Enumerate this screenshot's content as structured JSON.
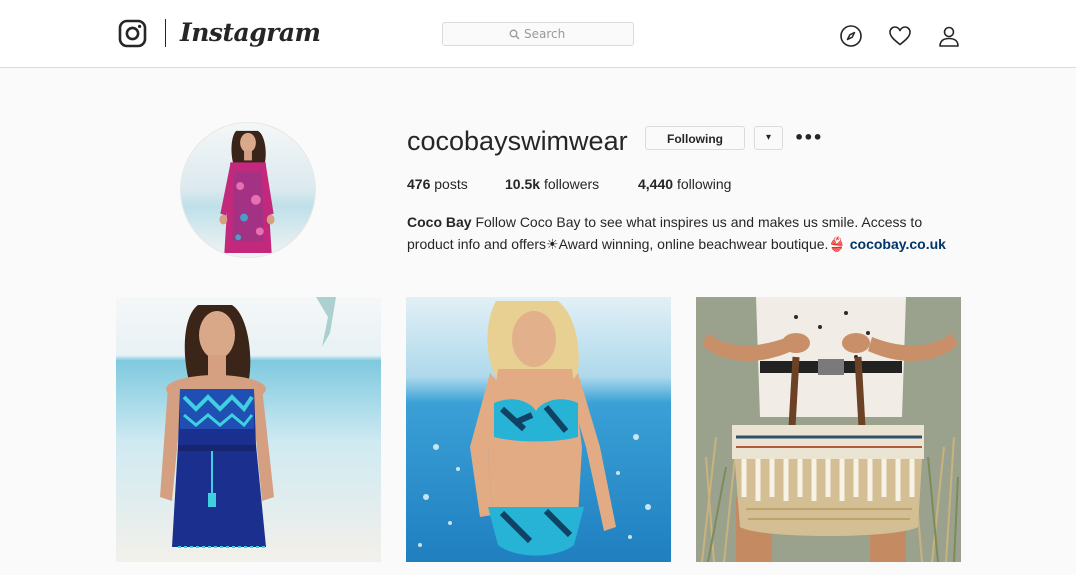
{
  "nav": {
    "brand": "Instagram",
    "search_placeholder": "Search",
    "icons": [
      "instagram-logo-icon",
      "search-icon",
      "compass-icon",
      "heart-icon",
      "profile-icon"
    ]
  },
  "profile": {
    "username": "cocobayswimwear",
    "following_button": "Following",
    "dropdown_glyph": "▾",
    "more_glyph": "•••",
    "stats": {
      "posts_count": "476",
      "posts_label": "posts",
      "followers_count": "10.5k",
      "followers_label": "followers",
      "following_count": "4,440",
      "following_label": "following"
    },
    "bio": {
      "name": "Coco Bay",
      "line1": "Follow Coco Bay to see what inspires us and makes us smile. Access to",
      "line2": "product info and offers☀Award winning, online beachwear boutique.👙",
      "link": "cocobay.co.uk"
    }
  },
  "colors": {
    "accent_link": "#003569",
    "border": "#dbdbdb",
    "background": "#fafafa"
  },
  "posts": [
    {
      "subject": "woman in navy strapless beach dress"
    },
    {
      "subject": "woman in turquoise print bikini"
    },
    {
      "subject": "straw fringe beach bag"
    }
  ]
}
